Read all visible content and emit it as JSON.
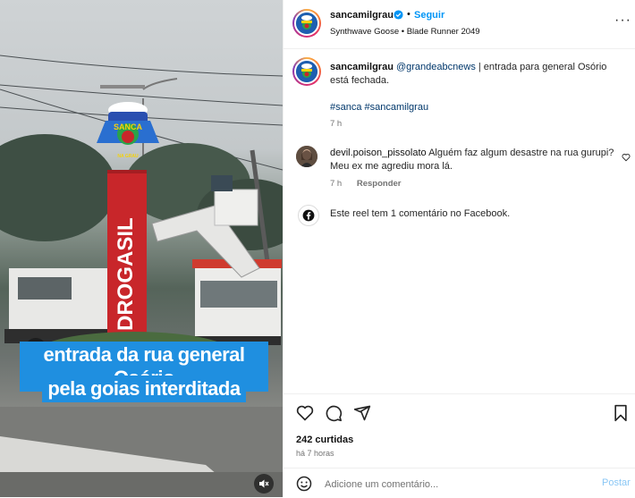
{
  "video": {
    "sign_text": "DROGASIL",
    "logo_top": "SANCA",
    "logo_bottom": "NA GRAU",
    "caption_line1": "entrada da rua general Osório",
    "caption_line2": "pela goias interditada"
  },
  "header": {
    "username": "sancamilgrau",
    "separator": "•",
    "follow_label": "Seguir",
    "audio": "Synthwave Goose • Blade Runner 2049",
    "more": "···"
  },
  "caption": {
    "username": "sancamilgrau",
    "mention": "@grandeabcnews",
    "text": " | entrada para general Osório está fechada.",
    "hashtags": "#sanca #sancamilgrau",
    "time": "7 h"
  },
  "comment": {
    "username": "devil.poison_pissolato",
    "text": " Alguém faz algum desastre na rua gurupi? Meu ex me agrediu mora lá.",
    "time": "7 h",
    "reply_label": "Responder"
  },
  "facebook": {
    "text": "Este reel tem 1 comentário no Facebook."
  },
  "stats": {
    "likes": "242 curtidas",
    "time_ago": "há 7 horas"
  },
  "add_comment": {
    "placeholder": "Adicione um comentário...",
    "post_label": "Postar"
  },
  "colors": {
    "link_blue": "#0095f6",
    "hashtag_blue": "#00376b",
    "caption_bg": "#1f8fe0",
    "sign_red": "#c8262a"
  }
}
